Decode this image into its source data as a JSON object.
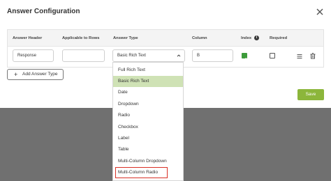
{
  "modal": {
    "title": "Answer Configuration",
    "save_label": "Save",
    "add_label": "Add Answer Type"
  },
  "table": {
    "headers": [
      "Answer Header",
      "Applicable to Rows",
      "Answer Type",
      "Column",
      "Index",
      "Required"
    ],
    "row": {
      "answer_header": "Response",
      "applicable_rows": "",
      "answer_type": "Basic Rich Text",
      "column": "B",
      "index_checked": true,
      "required_checked": false
    }
  },
  "dropdown": {
    "options": [
      "Full Rich Text",
      "Basic Rich Text",
      "Date",
      "Dropdown",
      "Radio",
      "Checkbox",
      "Label",
      "Table",
      "Multi-Column Dropdown",
      "Multi-Column Radio"
    ],
    "selected": "Basic Rich Text",
    "highlighted": "Multi-Column Radio"
  },
  "colors": {
    "accent_green": "#8cb63b",
    "selected_bg": "#cfe2b5",
    "checkbox_green": "#3d9b3a",
    "highlight_red": "#d93025"
  }
}
